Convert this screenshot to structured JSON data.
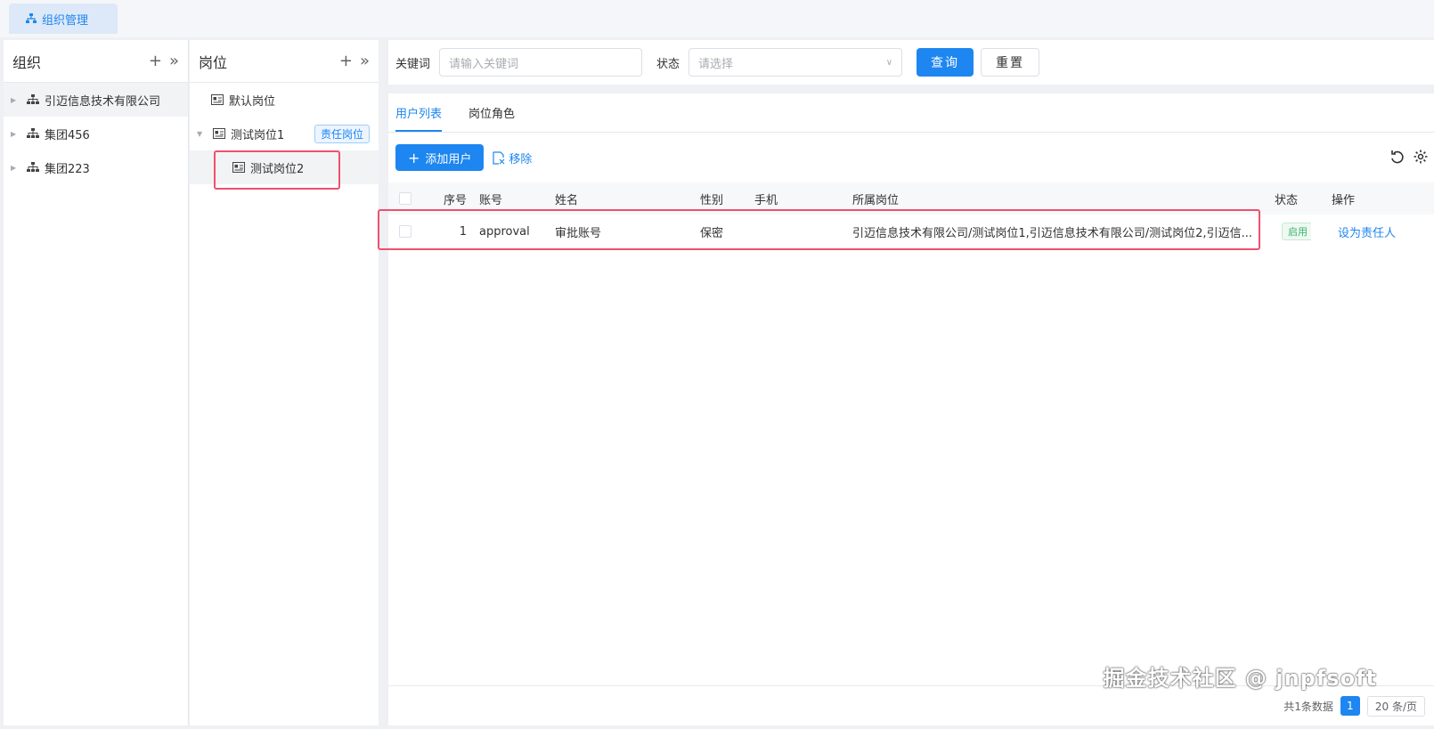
{
  "top_tab": {
    "label": "组织管理"
  },
  "org_panel": {
    "title": "组织",
    "items": [
      {
        "label": "引迈信息技术有限公司"
      },
      {
        "label": "集团456"
      },
      {
        "label": "集团223"
      }
    ]
  },
  "pos_panel": {
    "title": "岗位",
    "items": [
      {
        "label": "默认岗位"
      },
      {
        "label": "测试岗位1",
        "tag": "责任岗位"
      },
      {
        "label": "测试岗位2"
      }
    ]
  },
  "search": {
    "keyword_label": "关键词",
    "keyword_placeholder": "请输入关键词",
    "status_label": "状态",
    "status_placeholder": "请选择",
    "query_button": "查询",
    "reset_button": "重置"
  },
  "tabs": [
    {
      "label": "用户列表"
    },
    {
      "label": "岗位角色"
    }
  ],
  "toolbar": {
    "add_label": "添加用户",
    "remove_label": "移除"
  },
  "table": {
    "headers": [
      "序号",
      "账号",
      "姓名",
      "性别",
      "手机",
      "所属岗位",
      "状态",
      "操作"
    ],
    "rows": [
      {
        "index": "1",
        "account": "approval",
        "name": "审批账号",
        "gender": "保密",
        "phone": "",
        "posts": "引迈信息技术有限公司/测试岗位1,引迈信息技术有限公司/测试岗位2,引迈信...",
        "status": "启用",
        "action": "设为责任人"
      }
    ]
  },
  "footer": {
    "total": "共1条数据",
    "page": "1",
    "page_size": "20 条/页"
  },
  "watermark": "掘金技术社区 @ jnpfsoft",
  "colors": {
    "primary": "#1d86f0",
    "highlight_box": "#f0506e",
    "status_green": "#3cb371"
  }
}
